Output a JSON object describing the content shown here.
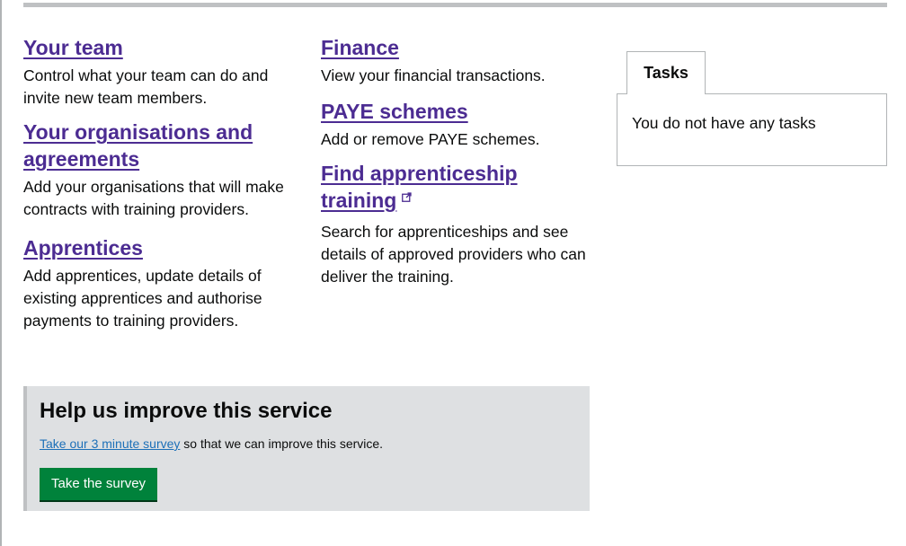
{
  "sections": {
    "your_team": {
      "title": "Your team",
      "description": "Control what your team can do and invite new team members."
    },
    "organisations": {
      "title": "Your organisations and agreements",
      "description": "Add your organisations that will make contracts with training providers."
    },
    "apprentices": {
      "title": "Apprentices",
      "description": "Add apprentices, update details of existing apprentices and authorise payments to training providers."
    },
    "finance": {
      "title": "Finance",
      "description": "View your financial transactions."
    },
    "paye": {
      "title": "PAYE schemes",
      "description": "Add or remove PAYE schemes."
    },
    "find_training": {
      "title": "Find apprenticeship training",
      "description": "Search for apprenticeships and see details of approved providers who can deliver the training.",
      "icon": "external-link-icon"
    }
  },
  "tasks": {
    "tab_label": "Tasks",
    "empty_message": "You do not have any tasks"
  },
  "survey": {
    "title": "Help us improve this service",
    "link_text": "Take our 3 minute survey",
    "text_suffix": " so that we can improve this service.",
    "button_label": "Take the survey"
  },
  "colors": {
    "link": "#4c2c92",
    "survey_link": "#1d70b8",
    "button": "#00823b",
    "survey_background": "#dee0e2"
  }
}
